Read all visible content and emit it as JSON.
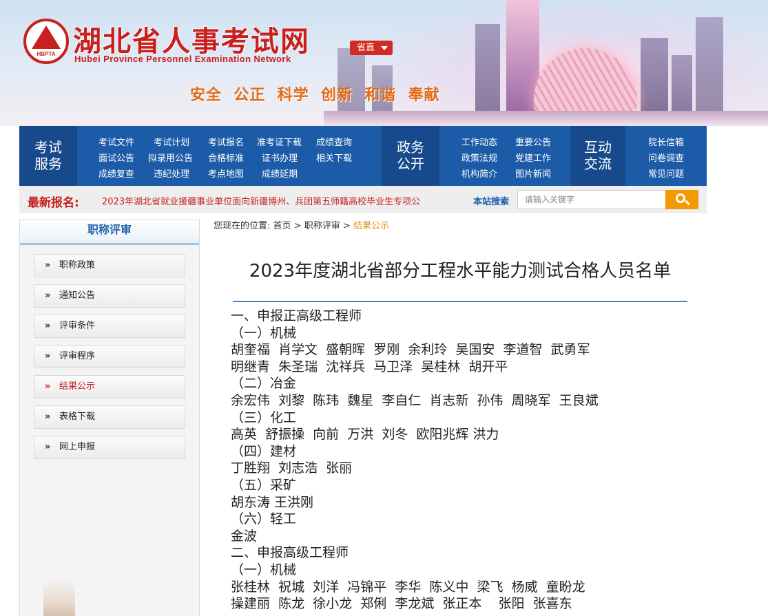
{
  "header": {
    "logo_text": "HBPTA",
    "site_title": "湖北省人事考试网",
    "site_subtitle": "Hubei Province Personnel Examination Network",
    "region_button": "省直",
    "slogan": "安全  公正  科学  创新  和谐  奉献"
  },
  "nav": {
    "exam_service": {
      "heading_line1": "考试",
      "heading_line2": "服务",
      "links": [
        "考试文件",
        "考试计划",
        "考试报名",
        "准考证下载",
        "成绩查询",
        "面试公告",
        "拟录用公告",
        "合格标准",
        "证书办理",
        "相关下载",
        "成绩复查",
        "违纪处理",
        "考点地图",
        "成绩延期"
      ]
    },
    "gov_affairs": {
      "heading_line1": "政务",
      "heading_line2": "公开",
      "links": [
        "工作动态",
        "重要公告",
        "政策法规",
        "党建工作",
        "机构简介",
        "图片新闻"
      ]
    },
    "interaction": {
      "heading_line1": "互动",
      "heading_line2": "交流",
      "links": [
        "院长信箱",
        "问卷调查",
        "常见问题"
      ]
    }
  },
  "ticker": {
    "label": "最新报名:",
    "text": "2023年湖北省就业援疆事业单位面向新疆博州、兵团第五师籍高校毕业生专项公"
  },
  "search": {
    "label": "本站搜索",
    "placeholder": "请输入关键字",
    "icon": "search-icon"
  },
  "sidebar": {
    "title": "职称评审",
    "items": [
      {
        "label": "职称政策",
        "active": false
      },
      {
        "label": "通知公告",
        "active": false
      },
      {
        "label": "评审条件",
        "active": false
      },
      {
        "label": "评审程序",
        "active": false
      },
      {
        "label": "结果公示",
        "active": true
      },
      {
        "label": "表格下载",
        "active": false
      },
      {
        "label": "网上申报",
        "active": false
      }
    ]
  },
  "breadcrumb": {
    "prefix": "您现在的位置:",
    "items": [
      "首页",
      "职称评审"
    ],
    "current": "结果公示",
    "separator": ">"
  },
  "article": {
    "title": "2023年度湖北省部分工程水平能力测试合格人员名单",
    "lines": [
      {
        "type": "sec",
        "text": "一、申报正高级工程师"
      },
      {
        "type": "cat",
        "text": "（一）机械"
      },
      {
        "type": "names",
        "text": "胡奎福  肖学文  盛朝晖  罗刚  余利玲  吴国安  李道智  武勇军"
      },
      {
        "type": "names",
        "text": "明继青  朱圣瑞  沈祥兵  马卫泽  吴桂林  胡开平"
      },
      {
        "type": "cat",
        "text": "（二）冶金"
      },
      {
        "type": "names",
        "text": "余宏伟  刘黎  陈玮  魏星  李自仁  肖志新  孙伟  周晓军  王良斌"
      },
      {
        "type": "cat",
        "text": "（三）化工"
      },
      {
        "type": "names",
        "text": "高英  舒振操  向前  万洪  刘冬  欧阳兆辉 洪力"
      },
      {
        "type": "cat",
        "text": "（四）建材"
      },
      {
        "type": "names",
        "text": "丁胜翔  刘志浩  张丽"
      },
      {
        "type": "cat",
        "text": "（五）采矿"
      },
      {
        "type": "names",
        "text": "胡东涛 王洪刚"
      },
      {
        "type": "cat",
        "text": "（六）轻工"
      },
      {
        "type": "names",
        "text": "金波"
      },
      {
        "type": "sec",
        "text": "二、申报高级工程师"
      },
      {
        "type": "cat",
        "text": "（一）机械"
      },
      {
        "type": "names",
        "text": "张桂林  祝城  刘洋  冯锦平  李华  陈义中  梁飞  杨威  童盼龙"
      },
      {
        "type": "names",
        "text": "操建丽  陈龙  徐小龙  郑俐  李龙斌  张正本    张阳  张喜东"
      }
    ]
  },
  "colors": {
    "brand_red": "#c8201f",
    "nav_blue": "#1c5ba8",
    "accent_orange": "#f29b00",
    "breadcrumb_current": "#e08a00"
  }
}
